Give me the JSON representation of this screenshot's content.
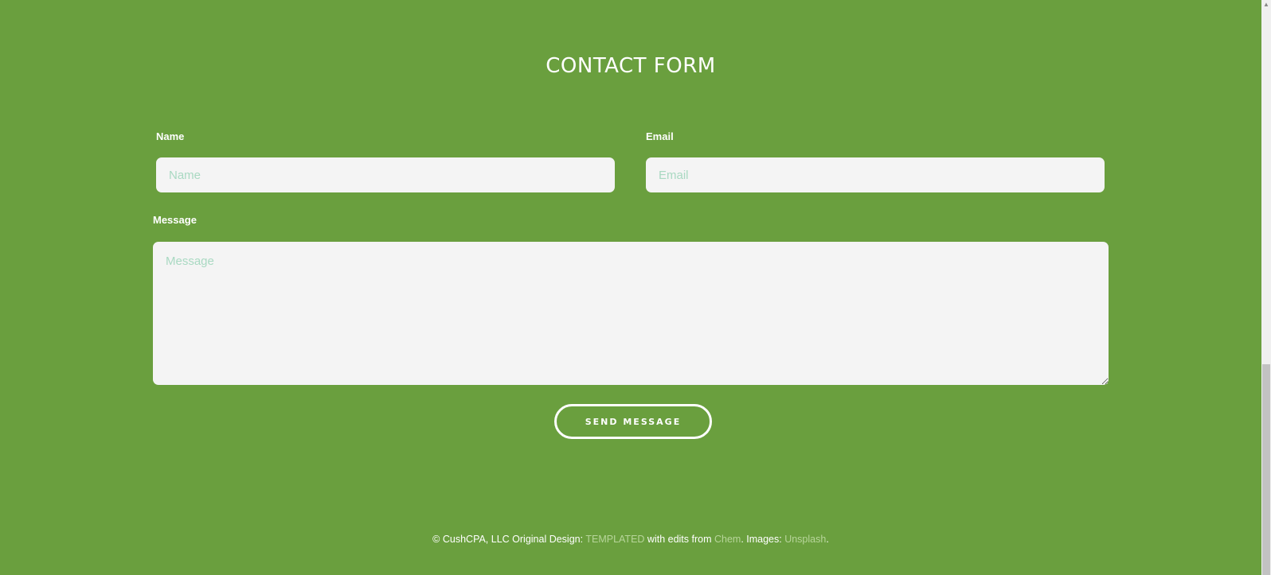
{
  "form": {
    "title": "CONTACT FORM",
    "name_label": "Name",
    "name_placeholder": "Name",
    "email_label": "Email",
    "email_placeholder": "Email",
    "message_label": "Message",
    "message_placeholder": "Message",
    "send_label": "SEND MESSAGE"
  },
  "footer": {
    "prefix": "© CushCPA, LLC Original Design: ",
    "link1": "TEMPLATED",
    "middle": " with edits from ",
    "link2": "Chem",
    "images_text": ". Images: ",
    "link3": "Unsplash",
    "suffix": "."
  },
  "colors": {
    "background": "#6a9f3e",
    "field_bg": "#f4f4f4",
    "placeholder": "#a9d9c2",
    "footer_link": "#b7d59a"
  },
  "icons": {
    "scroll_up": "up-arrow-icon"
  }
}
